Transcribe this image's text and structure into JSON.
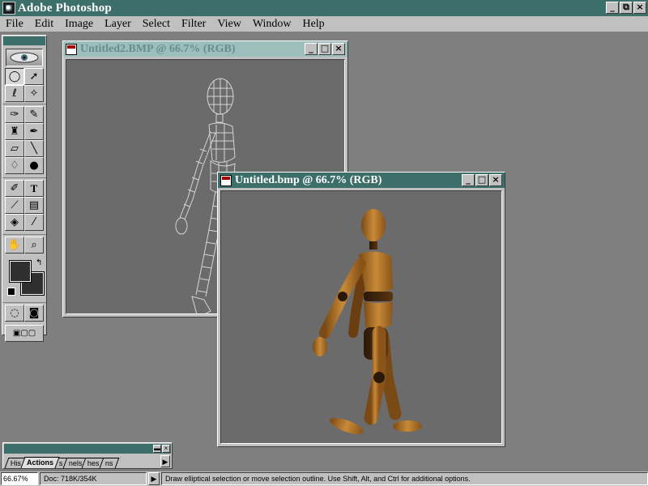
{
  "app": {
    "title": "Adobe Photoshop",
    "window_buttons": {
      "minimize": "_",
      "restore": "⧉",
      "close": "×"
    }
  },
  "menu": {
    "items": [
      {
        "label": "File"
      },
      {
        "label": "Edit"
      },
      {
        "label": "Image"
      },
      {
        "label": "Layer"
      },
      {
        "label": "Select"
      },
      {
        "label": "Filter"
      },
      {
        "label": "View"
      },
      {
        "label": "Window"
      },
      {
        "label": "Help"
      }
    ]
  },
  "toolbox": {
    "tools": [
      {
        "name": "elliptical-marquee-tool",
        "icon": "ellipse-icon",
        "glyph": "◯",
        "active": true
      },
      {
        "name": "move-tool",
        "icon": "move-arrow-icon",
        "glyph": "➤"
      },
      {
        "name": "lasso-tool",
        "icon": "lasso-icon",
        "glyph": "ℓ"
      },
      {
        "name": "magic-wand-tool",
        "icon": "magic-wand-icon",
        "glyph": "⁄"
      },
      {
        "name": "airbrush-tool",
        "icon": "airbrush-icon",
        "glyph": "✑"
      },
      {
        "name": "paintbrush-tool",
        "icon": "paintbrush-icon",
        "glyph": "✎"
      },
      {
        "name": "rubber-stamp-tool",
        "icon": "rubber-stamp-icon",
        "glyph": "♜"
      },
      {
        "name": "history-brush-tool",
        "icon": "history-brush-icon",
        "glyph": "✒"
      },
      {
        "name": "eraser-tool",
        "icon": "eraser-icon",
        "glyph": "▱"
      },
      {
        "name": "line-tool",
        "icon": "line-icon",
        "glyph": "╲"
      },
      {
        "name": "blur-tool",
        "icon": "blur-drop-icon",
        "glyph": "💧"
      },
      {
        "name": "burn-tool",
        "icon": "burn-icon",
        "glyph": "●"
      },
      {
        "name": "pen-tool",
        "icon": "pen-icon",
        "glyph": "✐"
      },
      {
        "name": "type-tool",
        "icon": "type-icon",
        "glyph": "T"
      },
      {
        "name": "measure-tool",
        "icon": "measure-icon",
        "glyph": "📏"
      },
      {
        "name": "gradient-tool",
        "icon": "gradient-icon",
        "glyph": "▤"
      },
      {
        "name": "paint-bucket-tool",
        "icon": "paint-bucket-icon",
        "glyph": "◈"
      },
      {
        "name": "eyedropper-tool",
        "icon": "eyedropper-icon",
        "glyph": "⁄"
      },
      {
        "name": "hand-tool",
        "icon": "hand-icon",
        "glyph": "✋"
      },
      {
        "name": "zoom-tool",
        "icon": "magnifier-icon",
        "glyph": "🔍"
      }
    ],
    "foreground_color": "#2f2f2f",
    "background_color": "#2f2f2f"
  },
  "documents": [
    {
      "title": "Untitled2.BMP @ 66.7% (RGB)",
      "active": false
    },
    {
      "title": "Untitled.bmp @ 66.7% (RGB)",
      "active": true
    }
  ],
  "actions_palette": {
    "tabs": [
      {
        "label": "His"
      },
      {
        "label": "Actions",
        "active": true
      },
      {
        "label": "s"
      },
      {
        "label": "nels"
      },
      {
        "label": "hes"
      },
      {
        "label": "ns"
      }
    ]
  },
  "status": {
    "zoom": "66.67%",
    "doc_size": "Doc: 718K/354K",
    "hint": "Draw elliptical selection or move selection outline.  Use Shift, Alt, and Ctrl for additional options."
  },
  "colors": {
    "active_title": "#3c6e6a",
    "inactive_title": "#9cbfbb",
    "face": "#c0c0c0",
    "desktop": "#7f7f7f",
    "canvas": "#6b6b6b",
    "mannequin": "#b07a30"
  }
}
